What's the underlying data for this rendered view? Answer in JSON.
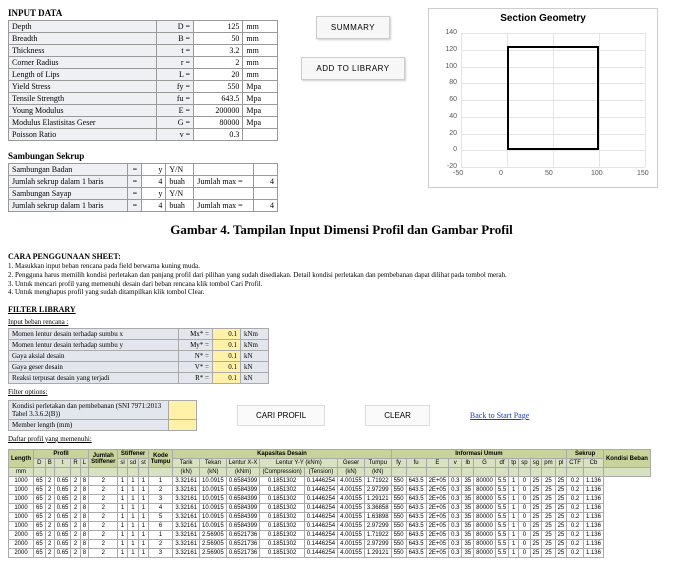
{
  "header": {
    "title": "INPUT DATA"
  },
  "dims": {
    "rows": [
      {
        "label": "Depth",
        "sym": "D =",
        "val": "125",
        "unit": "mm"
      },
      {
        "label": "Breadth",
        "sym": "B =",
        "val": "50",
        "unit": "mm"
      },
      {
        "label": "Thickness",
        "sym": "t =",
        "val": "3.2",
        "unit": "mm"
      },
      {
        "label": "Corner Radius",
        "sym": "r =",
        "val": "2",
        "unit": "mm"
      },
      {
        "label": "Length of Lips",
        "sym": "L =",
        "val": "20",
        "unit": "mm"
      },
      {
        "label": "Yield Stress",
        "sym": "fy =",
        "val": "550",
        "unit": "Mpa"
      },
      {
        "label": "Tensile Strength",
        "sym": "fu =",
        "val": "643.5",
        "unit": "Mpa"
      },
      {
        "label": "Young Modulus",
        "sym": "E =",
        "val": "200000",
        "unit": "Mpa"
      },
      {
        "label": "Modulus Elastisitas Geser",
        "sym": "G =",
        "val": "80000",
        "unit": "Mpa"
      },
      {
        "label": "Poisson Ratio",
        "sym": "v =",
        "val": "0.3",
        "unit": ""
      }
    ]
  },
  "samb": {
    "title": "Sambungan Sekrup",
    "rows": [
      {
        "label": "Sambungan Badan",
        "eq": "=",
        "val": "y",
        "yn": "Y/N",
        "jl": "",
        "jv": ""
      },
      {
        "label": "Jumlah sekrup dalam 1 baris",
        "eq": "=",
        "val": "4",
        "yn": "buah",
        "jl": "Jumlah max =",
        "jv": "4"
      },
      {
        "label": "Sambungan Sayap",
        "eq": "=",
        "val": "y",
        "yn": "Y/N",
        "jl": "",
        "jv": ""
      },
      {
        "label": "Jumlah sekrup dalam 1 baris",
        "eq": "=",
        "val": "4",
        "yn": "buah",
        "jl": "Jumlah max =",
        "jv": "4"
      }
    ]
  },
  "buttons": {
    "summary": "SUMMARY",
    "add": "ADD TO LIBRARY",
    "cari": "CARI PROFIL",
    "clear": "CLEAR",
    "back": "Back to Start Page"
  },
  "chart_data": {
    "type": "line",
    "title": "Section Geometry",
    "xlim": [
      -50,
      150
    ],
    "ylim": [
      -20,
      140
    ],
    "xticks": [
      -50,
      0,
      50,
      100,
      150
    ],
    "yticks": [
      -20,
      0,
      20,
      40,
      60,
      80,
      100,
      120,
      140
    ]
  },
  "caption": "Gambar 4. Tampilan Input Dimensi Profil dan Gambar Profil",
  "cara": {
    "title": "CARA PENGGUNAAN SHEET:",
    "lines": [
      "1. Masukkan input beban rencana pada field berwarna kuning muda.",
      "2. Pengguna harus memilih kondisi perletakan dan panjang profil dari pilihan yang sudah disediakan. Detail kondisi perletakan dan pembebanan dapat dilihat pada tombol merah.",
      "3. Untuk mencari profil yang memenuhi desain dari beban rencana klik tombol Cari Profil.",
      "4. Untuk menghapus profil yang sudah ditampilkan klik tombol Clear."
    ]
  },
  "filter": {
    "title": "FILTER LIBRARY",
    "sub1": "Input beban rencana :",
    "rows": [
      {
        "label": "Momen lentur desain terhadap sumbu x",
        "sym": "Mx* =",
        "val": "0.1",
        "unit": "kNm"
      },
      {
        "label": "Momen lentur desain terhadap sumbu y",
        "sym": "My* =",
        "val": "0.1",
        "unit": "kNm"
      },
      {
        "label": "Gaya aksial desain",
        "sym": "N* =",
        "val": "0.1",
        "unit": "kN"
      },
      {
        "label": "Gaya geser desain",
        "sym": "V* =",
        "val": "0.1",
        "unit": "kN"
      },
      {
        "label": "Reaksi terpusat desain yang terjadi",
        "sym": "R* =",
        "val": "0.1",
        "unit": "kN"
      }
    ],
    "sub2": "Filter options:",
    "opt1": "Kondisi perletakan dan pembebanan\n(SNI 7971:2013 Tabel 3.3.6.2(B))",
    "opt2": "Member length (mm)",
    "opt1v": "",
    "opt2v": "",
    "sub3": "Daftar profil yang memenuhi:"
  },
  "res": {
    "groups": [
      "Length",
      "Profil",
      "Jumlah Stiffener",
      "Stiffener",
      "Kode Tumpu",
      "Kapasitas Desain",
      "Informasi Umum",
      "Sekrup",
      "Kondisi Beban"
    ],
    "sub": {
      "Length": [
        "mm"
      ],
      "Profil": [
        "D",
        "B",
        "t",
        "R",
        "L"
      ],
      "Jumlah Stiffener": [
        ""
      ],
      "Stiffener": [
        "sl",
        "sd",
        "st"
      ],
      "Kode Tumpu": [
        ""
      ],
      "Kapasitas Desain": [
        "Tarik",
        "Tekan",
        "Lentur X-X",
        "Lentur Y-Y",
        "Geser",
        "Tumpu"
      ],
      "units_cap": [
        "(kN)",
        "(kN)",
        "(kNm)",
        "(Compression)",
        "(Tension)",
        "(kN)",
        "(kN)"
      ],
      "Informasi Umum": [
        "fy",
        "fu",
        "E",
        "v",
        "lb",
        "G",
        "df",
        "tp",
        "sp",
        "sg",
        "pm",
        "pl"
      ],
      "Sekrup": [
        "CTF",
        "Cb"
      ],
      "Kondisi Beban": [
        ""
      ]
    },
    "cap_sub2": [
      "",
      "",
      "",
      "Lentur Y-Y (kNm)",
      "",
      "",
      ""
    ],
    "rows": [
      [
        "1000",
        "65",
        "2",
        "0.65",
        "2",
        "8",
        "2",
        "1",
        "1",
        "1",
        "1",
        "3.32161",
        "10.0915",
        "0.6584399",
        "0.1851302",
        "0.1446254",
        "4.00155",
        "1.71922",
        "550",
        "643.5",
        "2E+05",
        "0.3",
        "35",
        "80000",
        "5.5",
        "1",
        "0",
        "25",
        "25",
        "25",
        "0.2",
        "1.136"
      ],
      [
        "1000",
        "65",
        "2",
        "0.65",
        "2",
        "8",
        "2",
        "1",
        "1",
        "1",
        "2",
        "3.32161",
        "10.0915",
        "0.6584399",
        "0.1851302",
        "0.1446254",
        "4.00155",
        "2.97299",
        "550",
        "643.5",
        "2E+05",
        "0.3",
        "35",
        "80000",
        "5.5",
        "1",
        "0",
        "25",
        "25",
        "25",
        "0.2",
        "1.136"
      ],
      [
        "1000",
        "65",
        "2",
        "0.65",
        "2",
        "8",
        "2",
        "1",
        "1",
        "1",
        "3",
        "3.32161",
        "10.0915",
        "0.6584399",
        "0.1851302",
        "0.1446254",
        "4.00155",
        "1.29121",
        "550",
        "643.5",
        "2E+05",
        "0.3",
        "35",
        "80000",
        "5.5",
        "1",
        "0",
        "25",
        "25",
        "25",
        "0.2",
        "1.136"
      ],
      [
        "1000",
        "65",
        "2",
        "0.65",
        "2",
        "8",
        "2",
        "1",
        "1",
        "1",
        "4",
        "3.32161",
        "10.0915",
        "0.6584399",
        "0.1851302",
        "0.1446254",
        "4.00155",
        "3.36858",
        "550",
        "643.5",
        "2E+05",
        "0.3",
        "35",
        "80000",
        "5.5",
        "1",
        "0",
        "25",
        "25",
        "25",
        "0.2",
        "1.136"
      ],
      [
        "1000",
        "65",
        "2",
        "0.65",
        "2",
        "8",
        "2",
        "1",
        "1",
        "1",
        "5",
        "3.32161",
        "10.0915",
        "0.6584399",
        "0.1851302",
        "0.1446254",
        "4.00155",
        "1.63898",
        "550",
        "643.5",
        "2E+05",
        "0.3",
        "35",
        "80000",
        "5.5",
        "1",
        "0",
        "25",
        "25",
        "25",
        "0.2",
        "1.136"
      ],
      [
        "1000",
        "65",
        "2",
        "0.65",
        "2",
        "8",
        "2",
        "1",
        "1",
        "1",
        "6",
        "3.32161",
        "10.0915",
        "0.6584399",
        "0.1851302",
        "0.1446254",
        "4.00155",
        "2.97299",
        "550",
        "643.5",
        "2E+05",
        "0.3",
        "35",
        "80000",
        "5.5",
        "1",
        "0",
        "25",
        "25",
        "25",
        "0.2",
        "1.136"
      ],
      [
        "2000",
        "65",
        "2",
        "0.65",
        "2",
        "8",
        "2",
        "1",
        "1",
        "1",
        "1",
        "3.32161",
        "2.56905",
        "0.6521736",
        "0.1851302",
        "0.1446254",
        "4.00155",
        "1.71922",
        "550",
        "643.5",
        "2E+05",
        "0.3",
        "35",
        "80000",
        "5.5",
        "1",
        "0",
        "25",
        "25",
        "25",
        "0.2",
        "1.136"
      ],
      [
        "2000",
        "65",
        "2",
        "0.65",
        "2",
        "8",
        "2",
        "1",
        "1",
        "1",
        "2",
        "3.32161",
        "2.56905",
        "0.6521736",
        "0.1851302",
        "0.1446254",
        "4.00155",
        "2.97299",
        "550",
        "643.5",
        "2E+05",
        "0.3",
        "35",
        "80000",
        "5.5",
        "1",
        "0",
        "25",
        "25",
        "25",
        "0.2",
        "1.136"
      ],
      [
        "2000",
        "65",
        "2",
        "0.65",
        "2",
        "8",
        "2",
        "1",
        "1",
        "1",
        "3",
        "3.32161",
        "2.56905",
        "0.6521736",
        "0.1851302",
        "0.1446254",
        "4.00155",
        "1.29121",
        "550",
        "643.5",
        "2E+05",
        "0.3",
        "35",
        "80000",
        "5.5",
        "1",
        "0",
        "25",
        "25",
        "25",
        "0.2",
        "1.136"
      ]
    ]
  }
}
